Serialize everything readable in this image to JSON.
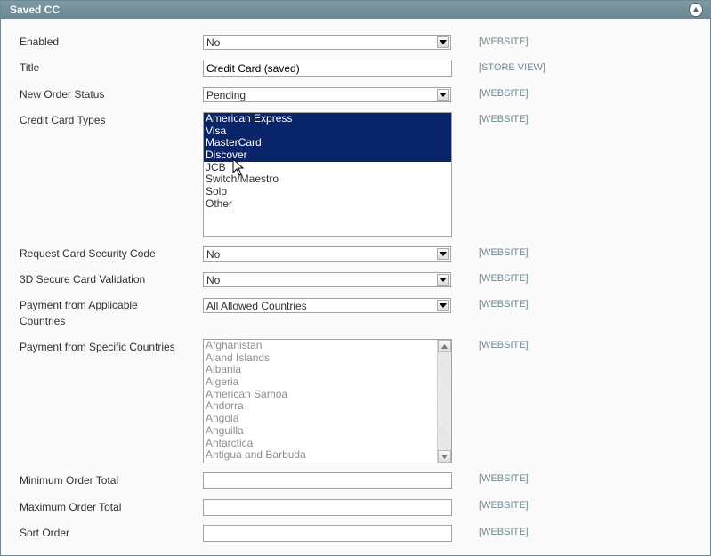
{
  "panel": {
    "title": "Saved CC"
  },
  "fields": {
    "enabled": {
      "label": "Enabled",
      "value": "No",
      "scope": "[WEBSITE]"
    },
    "title": {
      "label": "Title",
      "value": "Credit Card (saved)",
      "scope": "[STORE VIEW]"
    },
    "order_status": {
      "label": "New Order Status",
      "value": "Pending",
      "scope": "[WEBSITE]"
    },
    "cc_types": {
      "label": "Credit Card Types",
      "scope": "[WEBSITE]",
      "options": [
        "American Express",
        "Visa",
        "MasterCard",
        "Discover",
        "JCB",
        "Switch/Maestro",
        "Solo",
        "Other"
      ],
      "selected": [
        "American Express",
        "Visa",
        "MasterCard",
        "Discover"
      ]
    },
    "security_code": {
      "label": "Request Card Security Code",
      "value": "No",
      "scope": "[WEBSITE]"
    },
    "secure_3d": {
      "label": "3D Secure Card Validation",
      "value": "No",
      "scope": "[WEBSITE]"
    },
    "applicable_countries": {
      "label_line1": "Payment from Applicable",
      "label_line2": "Countries",
      "value": "All Allowed Countries",
      "scope": "[WEBSITE]"
    },
    "specific_countries": {
      "label": "Payment from Specific Countries",
      "scope": "[WEBSITE]",
      "options": [
        "Afghanistan",
        "Aland Islands",
        "Albania",
        "Algeria",
        "American Samoa",
        "Andorra",
        "Angola",
        "Anguilla",
        "Antarctica",
        "Antigua and Barbuda"
      ]
    },
    "min_total": {
      "label": "Minimum Order Total",
      "value": "",
      "scope": "[WEBSITE]"
    },
    "max_total": {
      "label": "Maximum Order Total",
      "value": "",
      "scope": "[WEBSITE]"
    },
    "sort_order": {
      "label": "Sort Order",
      "value": "",
      "scope": "[WEBSITE]"
    }
  },
  "icons": {
    "collapse": "collapse-up-icon",
    "dropdown": "dropdown-arrow-icon",
    "cursor": "mouse-pointer-icon"
  },
  "colors": {
    "header": "#6b8792",
    "selection": "#0a246a",
    "scope": "#6f8992"
  }
}
